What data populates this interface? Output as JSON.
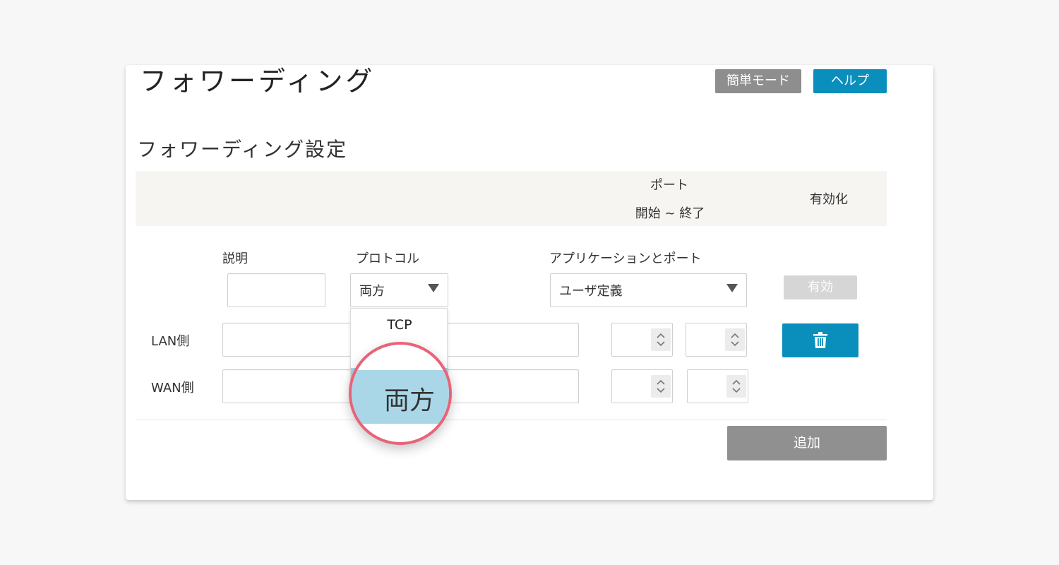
{
  "page": {
    "title": "フォワーディング",
    "simple_mode_label": "簡単モード",
    "help_label": "ヘルプ",
    "section_title": "フォワーディング設定"
  },
  "table_header": {
    "port_line1": "ポート",
    "port_line2": "開始 ~ 終了",
    "enable": "有効化"
  },
  "form": {
    "description_label": "説明",
    "protocol_label": "プロトコル",
    "protocol_value": "両方",
    "app_port_label": "アプリケーションとポート",
    "app_port_value": "ユーザ定義",
    "enable_button": "有効",
    "lan_label": "LAN側",
    "wan_label": "WAN側",
    "add_button": "追加"
  },
  "dropdown": {
    "options": [
      "TCP",
      "両方"
    ],
    "highlighted": "両方"
  },
  "colors": {
    "accent": "#0a8fbd",
    "highlight": "#a9d7e7",
    "magnifier_ring": "#e86378"
  }
}
